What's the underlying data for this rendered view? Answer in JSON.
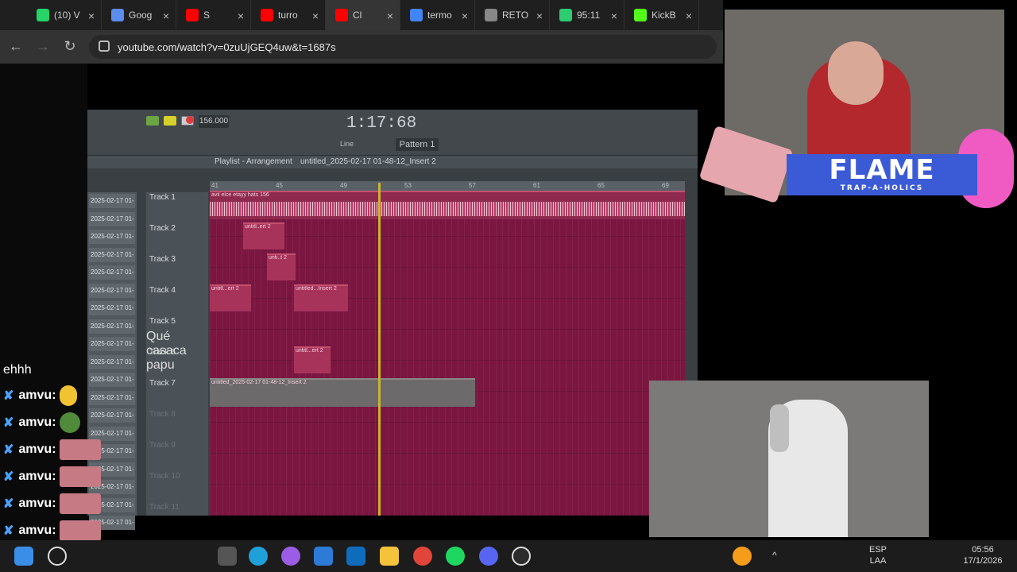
{
  "browser": {
    "tabs": [
      {
        "label": "(10) V",
        "icon": "whatsapp-icon",
        "color": "#25d366"
      },
      {
        "label": "Goog",
        "icon": "gemini-icon",
        "color": "#5b8def"
      },
      {
        "label": "S",
        "icon": "youtube-icon",
        "color": "#ff0000"
      },
      {
        "label": "turro",
        "icon": "youtube-icon",
        "color": "#ff0000"
      },
      {
        "label": "Cl",
        "icon": "youtube-icon",
        "color": "#ff0000"
      },
      {
        "label": "termo",
        "icon": "google-icon",
        "color": "#4285f4"
      },
      {
        "label": "RETO",
        "icon": "sheet-icon",
        "color": "#888888"
      },
      {
        "label": "95:11",
        "icon": "stock-icon",
        "color": "#2ecc71"
      },
      {
        "label": "KickB",
        "icon": "kick-icon",
        "color": "#53fc18"
      }
    ],
    "url": "youtube.com/watch?v=0zuUjGEQ4uw&t=1687s"
  },
  "daw": {
    "bpm": "156.000",
    "time": "1:17:68",
    "pattern": "Pattern 1",
    "mode_label": "Line",
    "playlist_title": "Playlist - Arrangement",
    "playlist_file": "untitled_2025-02-17 01-48-12_Insert 2",
    "ruler_marks": [
      "41",
      "45",
      "49",
      "53",
      "57",
      "61",
      "65",
      "69"
    ],
    "tracks": [
      "Track 1",
      "Track 2",
      "Track 3",
      "Track 4",
      "Track 5",
      "Track 6",
      "Track 7",
      "Track 8",
      "Track 9",
      "Track 10",
      "Track 11"
    ],
    "clip_labels": {
      "main": "avil elce etayy hats 156",
      "insert2": "untitled_2025-02-17 01-48-12_Insert 2",
      "c2": "untitl..ert 2",
      "c3": "unti..t 2",
      "c4a": "untitl...ert 2",
      "c4b": "untitled...Insert 2",
      "c6": "untitl...ert 2"
    },
    "browser_items": [
      "2025-02-17 01-",
      "2025-02-17 01-",
      "2025-02-17 01-",
      "2025-02-17 01-",
      "2025-02-17 01-",
      "2025-02-17 01-",
      "2025-02-17 01-",
      "2025-02-17 01-",
      "2025-02-17 01-",
      "2025-02-17 01-",
      "2025-02-17 01-",
      "2025-02-17 01-",
      "2025-02-17 01-",
      "2025-02-17 01-",
      "2025-02-17 01-",
      "2025-02-17 01-",
      "2025-02-17 01-",
      "2025-02-17 01-",
      "2025-02-17 01-"
    ]
  },
  "chat": {
    "partial": "Qué casaca papu",
    "ehhh": "ehhh",
    "user": "amvu:",
    "lines": 7
  },
  "overlay": {
    "banner_title": "FLAME",
    "banner_sub": "TRAP-A-HOLICS"
  },
  "taskbar": {
    "lang1": "ESP",
    "lang2": "LAA",
    "time": "05:56",
    "date": "17/1/2026"
  }
}
